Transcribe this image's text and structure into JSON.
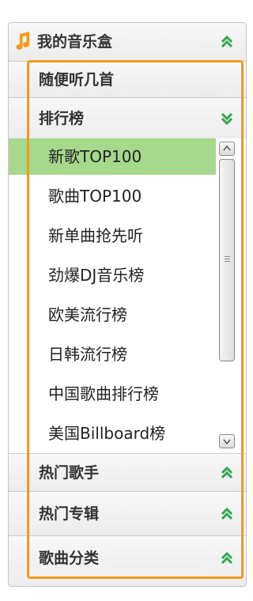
{
  "music_box": {
    "title": "我的音乐盒",
    "colors": {
      "accent_orange": "#f39a1e",
      "green_chevron": "#2ea84a",
      "active_row": "#a6d98c"
    },
    "sections": {
      "random": {
        "label": "随便听几首"
      },
      "charts": {
        "label": "排行榜",
        "expanded": true,
        "items": [
          {
            "label": "新歌TOP100",
            "selected": true
          },
          {
            "label": "歌曲TOP100"
          },
          {
            "label": "新单曲抢先听"
          },
          {
            "label": "劲爆DJ音乐榜"
          },
          {
            "label": "欧美流行榜"
          },
          {
            "label": "日韩流行榜"
          },
          {
            "label": "中国歌曲排行榜"
          },
          {
            "label": "美国Billboard榜"
          }
        ]
      },
      "hot_singers": {
        "label": "热门歌手"
      },
      "hot_albums": {
        "label": "热门专辑"
      },
      "categories": {
        "label": "歌曲分类"
      }
    },
    "icons": {
      "header": "music-note-icon",
      "collapse": "chevron-double-up-icon",
      "expand": "chevron-double-down-icon"
    }
  }
}
